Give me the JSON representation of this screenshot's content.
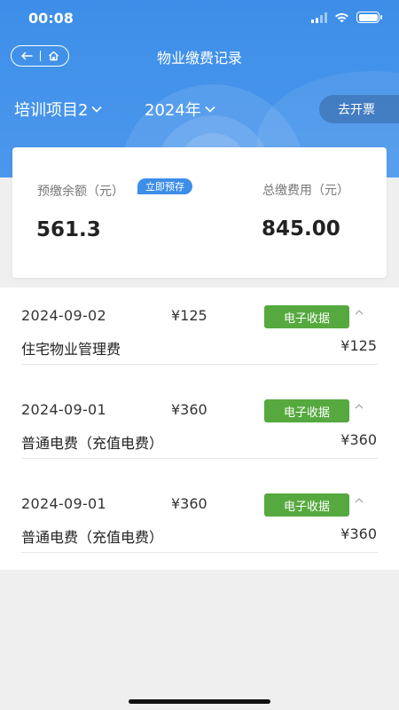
{
  "status_bar": {
    "time": "00:08"
  },
  "nav": {
    "title": "物业缴费记录"
  },
  "filters": {
    "project": "培训项目2",
    "year": "2024年",
    "invoice_label": "去开票"
  },
  "summary": {
    "prepay_label": "预缴余额（元）",
    "recharge_label": "立即预存",
    "prepay_value": "561.3",
    "total_label": "总缴费用（元）",
    "total_value": "845.00"
  },
  "records": [
    {
      "date": "2024-09-02",
      "amount": "¥125",
      "receipt_label": "电子收据",
      "item": "住宅物业管理费",
      "item_amount": "¥125"
    },
    {
      "date": "2024-09-01",
      "amount": "¥360",
      "receipt_label": "电子收据",
      "item": "普通电费（充值电费）",
      "item_amount": "¥360"
    },
    {
      "date": "2024-09-01",
      "amount": "¥360",
      "receipt_label": "电子收据",
      "item": "普通电费（充值电费）",
      "item_amount": "¥360"
    }
  ],
  "colors": {
    "header_blue": "#3d8ee8",
    "receipt_green": "#56a93f"
  }
}
